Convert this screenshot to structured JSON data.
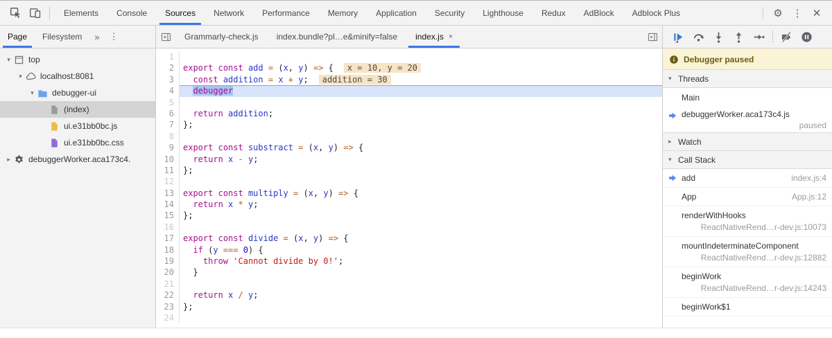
{
  "toolbar": {
    "tabs": [
      {
        "label": "Elements"
      },
      {
        "label": "Console"
      },
      {
        "label": "Sources",
        "active": true
      },
      {
        "label": "Network"
      },
      {
        "label": "Performance"
      },
      {
        "label": "Memory"
      },
      {
        "label": "Application"
      },
      {
        "label": "Security"
      },
      {
        "label": "Lighthouse"
      },
      {
        "label": "Redux"
      },
      {
        "label": "AdBlock"
      },
      {
        "label": "Adblock Plus"
      }
    ],
    "menu_glyph": "⋮",
    "close_glyph": "✕",
    "gear_glyph": "⚙"
  },
  "sidebar": {
    "tabs": [
      {
        "label": "Page",
        "active": true
      },
      {
        "label": "Filesystem"
      }
    ],
    "overflow_glyph": "»",
    "menu_glyph": "⋮",
    "tree": [
      {
        "label": "top",
        "icon": "frame",
        "depth": 0,
        "expander": "▾"
      },
      {
        "label": "localhost:8081",
        "icon": "cloud",
        "depth": 1,
        "expander": "▾"
      },
      {
        "label": "debugger-ui",
        "icon": "folder",
        "depth": 2,
        "expander": "▾"
      },
      {
        "label": "(index)",
        "icon": "doc-gray",
        "depth": 3,
        "expander": "",
        "selected": true
      },
      {
        "label": "ui.e31bb0bc.js",
        "icon": "doc-yellow",
        "depth": 3,
        "expander": ""
      },
      {
        "label": "ui.e31bb0bc.css",
        "icon": "doc-purple",
        "depth": 3,
        "expander": ""
      },
      {
        "label": "debuggerWorker.aca173c4.",
        "icon": "worker",
        "depth": 0,
        "expander": "▸"
      }
    ]
  },
  "editor": {
    "tabs": [
      {
        "label": "Grammarly-check.js"
      },
      {
        "label": "index.bundle?pl…e&minify=false"
      },
      {
        "label": "index.js",
        "active": true,
        "close": "×"
      }
    ],
    "lines": [
      {
        "n": 1,
        "tokens": []
      },
      {
        "n": 2,
        "tokens": [
          [
            "kw",
            "export"
          ],
          [
            "pl",
            " "
          ],
          [
            "kw",
            "const"
          ],
          [
            "pl",
            " "
          ],
          [
            "vr",
            "add"
          ],
          [
            "pl",
            " "
          ],
          [
            "op",
            "="
          ],
          [
            "pl",
            " ("
          ],
          [
            "vr",
            "x"
          ],
          [
            "pl",
            ", "
          ],
          [
            "vr",
            "y"
          ],
          [
            "pl",
            ") "
          ],
          [
            "op",
            "=>"
          ],
          [
            "pl",
            " {"
          ]
        ],
        "badge": "x = 10, y = 20"
      },
      {
        "n": 3,
        "tokens": [
          [
            "pl",
            "  "
          ],
          [
            "kw",
            "const"
          ],
          [
            "pl",
            " "
          ],
          [
            "vr",
            "addition"
          ],
          [
            "pl",
            " "
          ],
          [
            "op",
            "="
          ],
          [
            "pl",
            " "
          ],
          [
            "vr",
            "x"
          ],
          [
            "pl",
            " "
          ],
          [
            "op",
            "+"
          ],
          [
            "pl",
            " "
          ],
          [
            "vr",
            "y"
          ],
          [
            "pl",
            ";"
          ]
        ],
        "badge": "addition = 30"
      },
      {
        "n": 4,
        "tokens": [
          [
            "pl",
            "  "
          ],
          [
            "kwh",
            "debugger"
          ]
        ],
        "exec": true
      },
      {
        "n": 5,
        "tokens": []
      },
      {
        "n": 6,
        "tokens": [
          [
            "pl",
            "  "
          ],
          [
            "kw",
            "return"
          ],
          [
            "pl",
            " "
          ],
          [
            "vr",
            "addition"
          ],
          [
            "pl",
            ";"
          ]
        ]
      },
      {
        "n": 7,
        "tokens": [
          [
            "pl",
            "};"
          ]
        ]
      },
      {
        "n": 8,
        "tokens": []
      },
      {
        "n": 9,
        "tokens": [
          [
            "kw",
            "export"
          ],
          [
            "pl",
            " "
          ],
          [
            "kw",
            "const"
          ],
          [
            "pl",
            " "
          ],
          [
            "vr",
            "substract"
          ],
          [
            "pl",
            " "
          ],
          [
            "op",
            "="
          ],
          [
            "pl",
            " ("
          ],
          [
            "vr",
            "x"
          ],
          [
            "pl",
            ", "
          ],
          [
            "vr",
            "y"
          ],
          [
            "pl",
            ") "
          ],
          [
            "op",
            "=>"
          ],
          [
            "pl",
            " {"
          ]
        ]
      },
      {
        "n": 10,
        "tokens": [
          [
            "pl",
            "  "
          ],
          [
            "kw",
            "return"
          ],
          [
            "pl",
            " "
          ],
          [
            "vr",
            "x"
          ],
          [
            "pl",
            " "
          ],
          [
            "op",
            "-"
          ],
          [
            "pl",
            " "
          ],
          [
            "vr",
            "y"
          ],
          [
            "pl",
            ";"
          ]
        ]
      },
      {
        "n": 11,
        "tokens": [
          [
            "pl",
            "};"
          ]
        ]
      },
      {
        "n": 12,
        "tokens": []
      },
      {
        "n": 13,
        "tokens": [
          [
            "kw",
            "export"
          ],
          [
            "pl",
            " "
          ],
          [
            "kw",
            "const"
          ],
          [
            "pl",
            " "
          ],
          [
            "vr",
            "multiply"
          ],
          [
            "pl",
            " "
          ],
          [
            "op",
            "="
          ],
          [
            "pl",
            " ("
          ],
          [
            "vr",
            "x"
          ],
          [
            "pl",
            ", "
          ],
          [
            "vr",
            "y"
          ],
          [
            "pl",
            ") "
          ],
          [
            "op",
            "=>"
          ],
          [
            "pl",
            " {"
          ]
        ]
      },
      {
        "n": 14,
        "tokens": [
          [
            "pl",
            "  "
          ],
          [
            "kw",
            "return"
          ],
          [
            "pl",
            " "
          ],
          [
            "vr",
            "x"
          ],
          [
            "pl",
            " "
          ],
          [
            "op",
            "*"
          ],
          [
            "pl",
            " "
          ],
          [
            "vr",
            "y"
          ],
          [
            "pl",
            ";"
          ]
        ]
      },
      {
        "n": 15,
        "tokens": [
          [
            "pl",
            "};"
          ]
        ]
      },
      {
        "n": 16,
        "tokens": []
      },
      {
        "n": 17,
        "tokens": [
          [
            "kw",
            "export"
          ],
          [
            "pl",
            " "
          ],
          [
            "kw",
            "const"
          ],
          [
            "pl",
            " "
          ],
          [
            "vr",
            "divide"
          ],
          [
            "pl",
            " "
          ],
          [
            "op",
            "="
          ],
          [
            "pl",
            " ("
          ],
          [
            "vr",
            "x"
          ],
          [
            "pl",
            ", "
          ],
          [
            "vr",
            "y"
          ],
          [
            "pl",
            ") "
          ],
          [
            "op",
            "=>"
          ],
          [
            "pl",
            " {"
          ]
        ]
      },
      {
        "n": 18,
        "tokens": [
          [
            "pl",
            "  "
          ],
          [
            "kw",
            "if"
          ],
          [
            "pl",
            " ("
          ],
          [
            "vr",
            "y"
          ],
          [
            "pl",
            " "
          ],
          [
            "op",
            "==="
          ],
          [
            "pl",
            " "
          ],
          [
            "num",
            "0"
          ],
          [
            "pl",
            ") {"
          ]
        ]
      },
      {
        "n": 19,
        "tokens": [
          [
            "pl",
            "    "
          ],
          [
            "kw",
            "throw"
          ],
          [
            "pl",
            " "
          ],
          [
            "str",
            "'Cannot divide by 0!'"
          ],
          [
            "pl",
            ";"
          ]
        ]
      },
      {
        "n": 20,
        "tokens": [
          [
            "pl",
            "  }"
          ]
        ]
      },
      {
        "n": 21,
        "tokens": []
      },
      {
        "n": 22,
        "tokens": [
          [
            "pl",
            "  "
          ],
          [
            "kw",
            "return"
          ],
          [
            "pl",
            " "
          ],
          [
            "vr",
            "x"
          ],
          [
            "pl",
            " "
          ],
          [
            "op",
            "/"
          ],
          [
            "pl",
            " "
          ],
          [
            "vr",
            "y"
          ],
          [
            "pl",
            ";"
          ]
        ]
      },
      {
        "n": 23,
        "tokens": [
          [
            "pl",
            "};"
          ]
        ]
      },
      {
        "n": 24,
        "tokens": []
      }
    ]
  },
  "right_panel": {
    "controls": [
      "resume",
      "step-over",
      "step-into",
      "step-out",
      "step",
      "sep",
      "deactivate-breakpoints",
      "pause-on-exceptions"
    ],
    "paused_label": "Debugger paused",
    "threads": {
      "label": "Threads",
      "expander": "▾",
      "items": [
        {
          "label": "Main"
        },
        {
          "label": "debuggerWorker.aca173c4.js",
          "status": "paused",
          "active": true
        }
      ]
    },
    "watch": {
      "label": "Watch",
      "expander": "▸"
    },
    "call_stack": {
      "label": "Call Stack",
      "expander": "▾",
      "frames": [
        {
          "fn": "add",
          "loc": "index.js:4",
          "active": true
        },
        {
          "fn": "App",
          "loc": "App.js:12"
        },
        {
          "fn": "renderWithHooks",
          "loc": "ReactNativeRend…r-dev.js:10073",
          "wrap": true
        },
        {
          "fn": "mountIndeterminateComponent",
          "loc": "ReactNativeRend…r-dev.js:12882",
          "wrap": true
        },
        {
          "fn": "beginWork",
          "loc": "ReactNativeRend…r-dev.js:14243",
          "wrap": true
        },
        {
          "fn": "beginWork$1",
          "loc": ""
        }
      ]
    }
  },
  "colors": {
    "accent_blue": "#3b78e7",
    "resume_blue": "#3879d9",
    "exec_line_bg": "#d7e4f9",
    "badge_bg": "#f8e3c5",
    "banner_bg": "#fbf3d5",
    "banner_text": "#6b5c14"
  }
}
